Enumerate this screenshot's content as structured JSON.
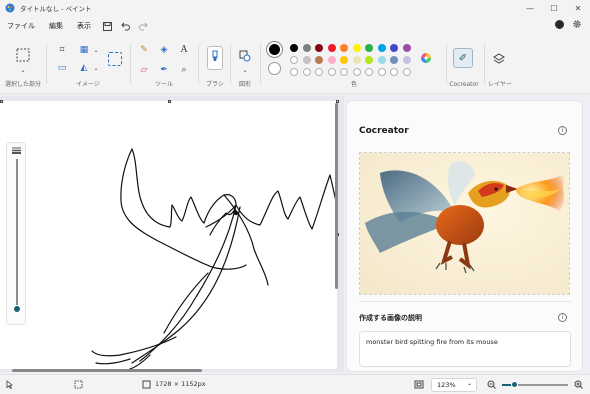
{
  "window": {
    "title": "タイトルなし - ペイント",
    "minimize": "—",
    "maximize": "☐",
    "close": "✕"
  },
  "menu": {
    "items": [
      "ファイル",
      "編集",
      "表示"
    ]
  },
  "ribbon": {
    "groups": {
      "selection": "選択した部分",
      "image": "イメージ",
      "tools": "ツール",
      "brush": "ブラシ",
      "shapes": "図形",
      "color": "色",
      "cocreator": "Cocreator",
      "layers": "レイヤー"
    },
    "palette_row1": [
      "#000000",
      "#7f7f7f",
      "#880015",
      "#ed1c24",
      "#ff7f27",
      "#fff200",
      "#22b14c",
      "#00a2e8",
      "#3f48cc",
      "#a349a4"
    ],
    "palette_row2": [
      "#ffffff",
      "#c3c3c3",
      "#b97a57",
      "#ffaec9",
      "#ffc90e",
      "#efe4b0",
      "#b5e61d",
      "#99d9ea",
      "#7092be",
      "#c8bfe7"
    ],
    "palette_row3": [
      "",
      "",
      "",
      "",
      "",
      "",
      "",
      "",
      "",
      ""
    ],
    "primary_color": "#000000",
    "secondary_color": "#ffffff",
    "icons": {
      "select": "select-rectangle-icon",
      "crop": "crop-icon",
      "resize": "resize-icon",
      "rotate": "rotate-icon",
      "pencil": "pencil-icon",
      "fill": "fill-bucket-icon",
      "text": "text-icon",
      "eraser": "eraser-icon",
      "picker": "color-picker-icon",
      "magnifier": "magnifier-icon",
      "brush": "brush-icon",
      "shapes": "shapes-icon",
      "edit_colors": "color-wheel-icon",
      "cocreator": "cocreator-icon",
      "layers": "layers-icon",
      "text_glyph": "A"
    }
  },
  "cocreator_panel": {
    "title": "Cocreator",
    "prompt_label": "作成する画像の説明",
    "prompt_value": "monster bird spitting fire from its mouse",
    "info": "i"
  },
  "status": {
    "canvas_size": "1728 × 1152px",
    "zoom": "123%",
    "zoom_level": 0.18
  },
  "brush_size_level": 0.0
}
